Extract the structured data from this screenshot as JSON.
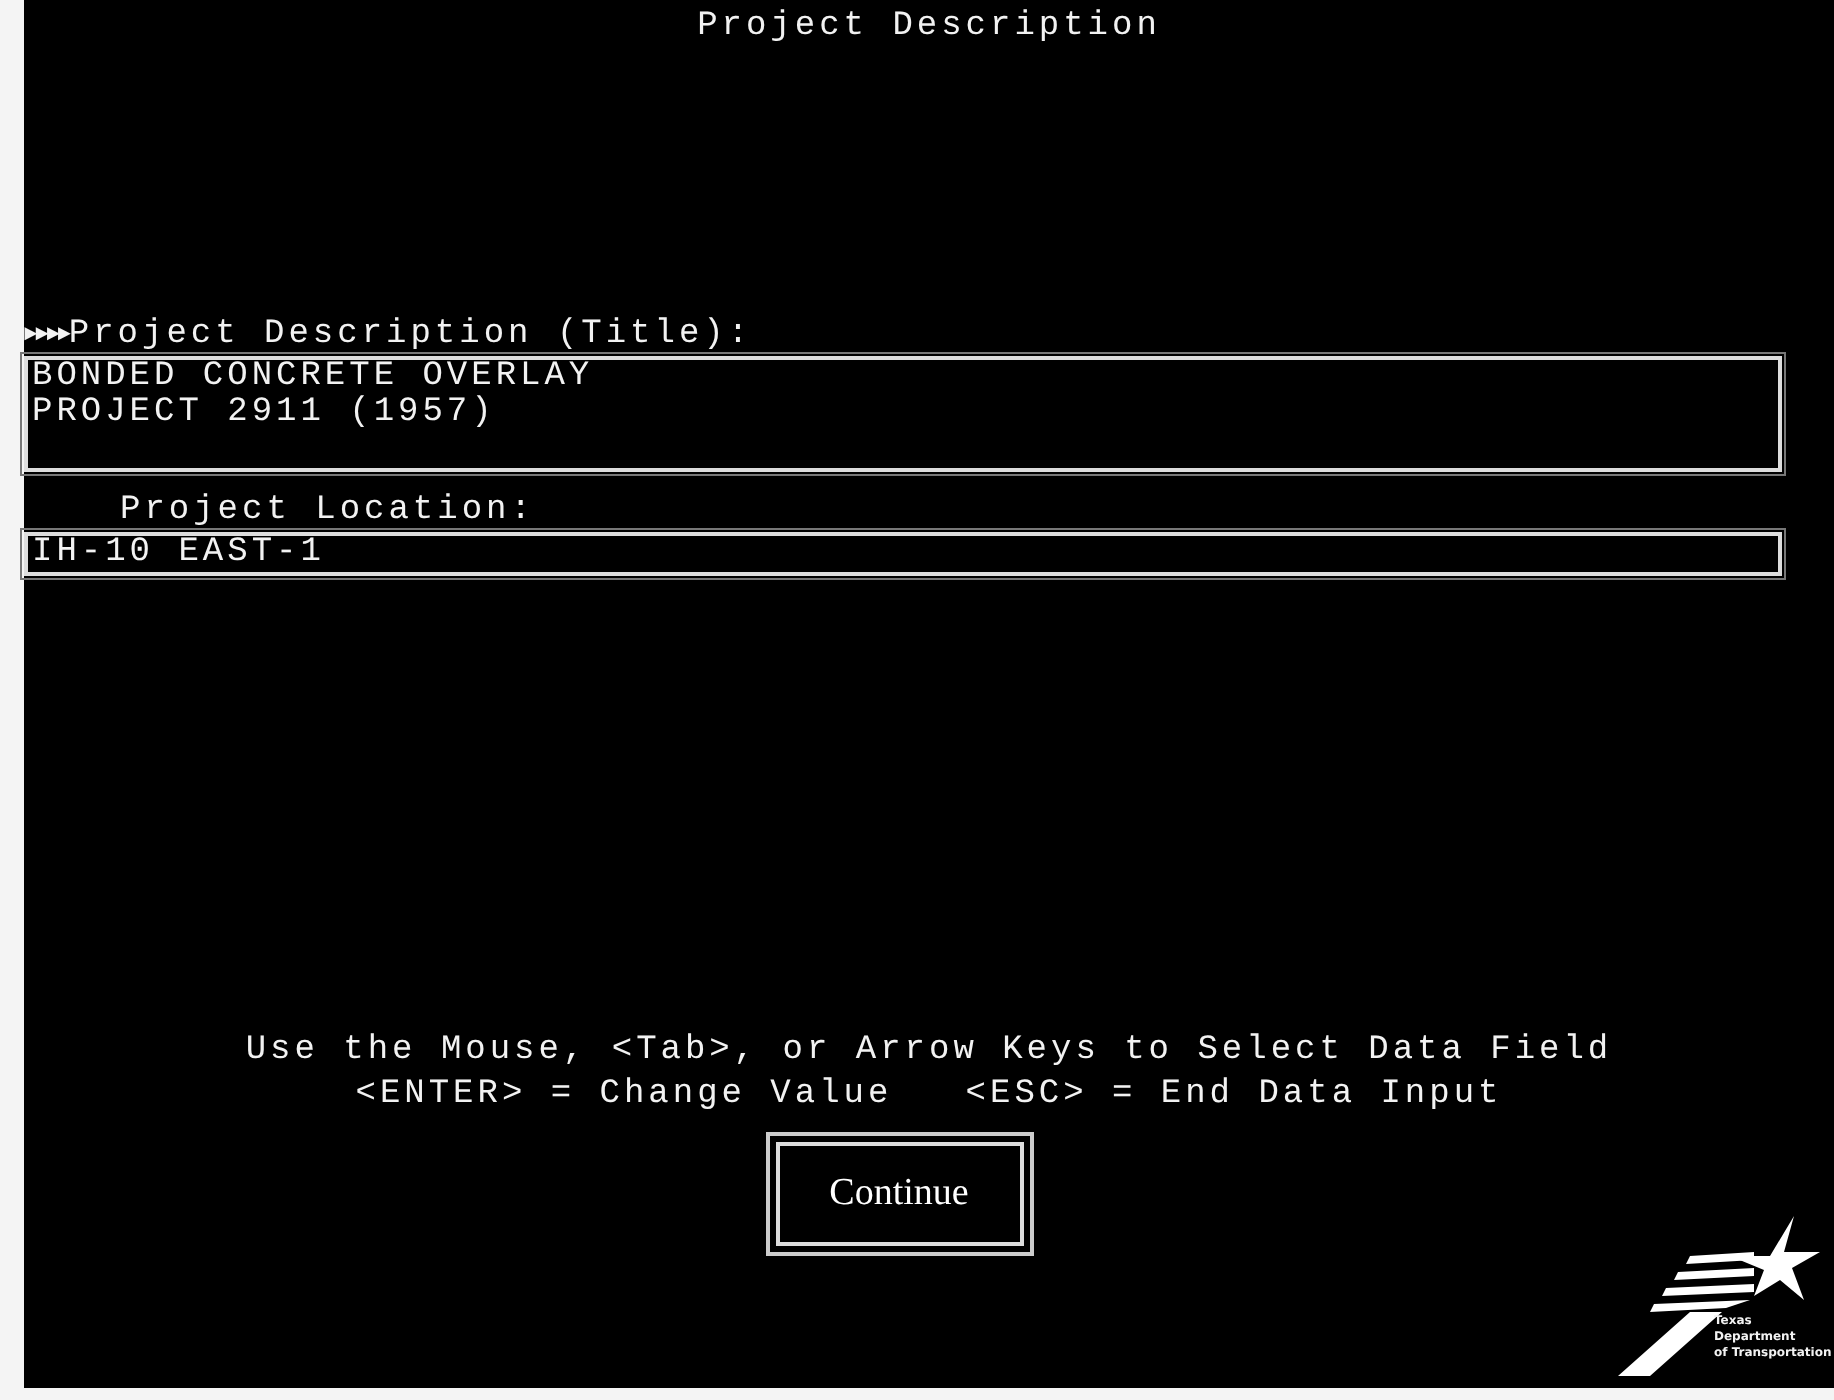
{
  "window": {
    "title": "Project Description"
  },
  "fields": [
    {
      "pointer": "►►►►",
      "label": "Project Description (Title):",
      "lines": [
        "BONDED CONCRETE OVERLAY",
        "PROJECT 2911 (1957)"
      ],
      "kind": "multiline"
    },
    {
      "label": "Project Location:",
      "lines": [
        "IH-10 EAST-1"
      ],
      "kind": "single"
    }
  ],
  "instructions": [
    "Use the Mouse, <Tab>, or Arrow Keys to Select Data Field",
    "<ENTER> = Change Value   <ESC> = End Data Input"
  ],
  "buttons": [
    "Continue"
  ],
  "logo": {
    "lines": [
      "Texas",
      "Department",
      "of Transportation"
    ]
  }
}
